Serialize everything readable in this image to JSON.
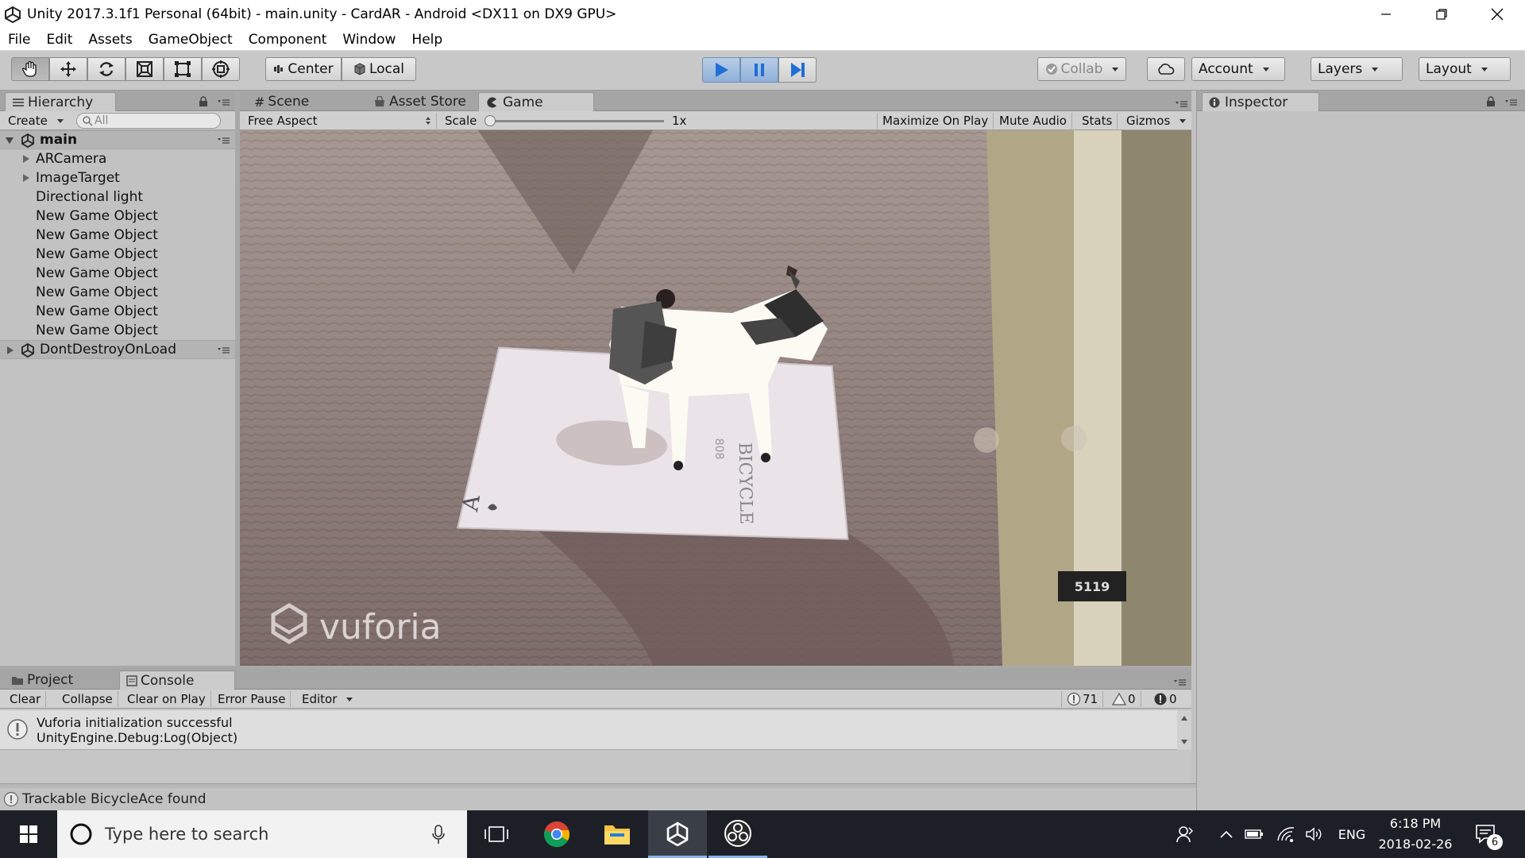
{
  "window": {
    "title": "Unity 2017.3.1f1 Personal (64bit) - main.unity - CardAR - Android <DX11 on DX9 GPU>"
  },
  "menu": [
    "File",
    "Edit",
    "Assets",
    "GameObject",
    "Component",
    "Window",
    "Help"
  ],
  "toolbar": {
    "pivot": "Center",
    "space": "Local",
    "collab": "Collab",
    "account": "Account",
    "layers": "Layers",
    "layout": "Layout"
  },
  "hierarchy": {
    "tab": "Hierarchy",
    "create": "Create",
    "search_placeholder": "All",
    "scene": "main",
    "items": [
      "ARCamera",
      "ImageTarget",
      "Directional light",
      "New Game Object",
      "New Game Object",
      "New Game Object",
      "New Game Object",
      "New Game Object",
      "New Game Object",
      "New Game Object"
    ],
    "dont_destroy": "DontDestroyOnLoad"
  },
  "center_tabs": {
    "scene": "Scene",
    "asset_store": "Asset Store",
    "game": "Game"
  },
  "game_bar": {
    "aspect": "Free Aspect",
    "scale_label": "Scale",
    "scale_value": "1x",
    "scale_fraction": 0,
    "maximize": "Maximize On Play",
    "mute": "Mute Audio",
    "stats": "Stats",
    "gizmos": "Gizmos"
  },
  "game_view": {
    "brand": "vuforia",
    "card_rank": "A",
    "card_brand": "BICYCLE",
    "card_number": "808",
    "door_sign": "5119"
  },
  "bottom_tabs": {
    "project": "Project",
    "console": "Console"
  },
  "console_bar": {
    "clear": "Clear",
    "collapse": "Collapse",
    "clear_on_play": "Clear on Play",
    "error_pause": "Error Pause",
    "editor": "Editor",
    "info_count": "71",
    "warn_count": "0",
    "error_count": "0"
  },
  "console_entry": {
    "line1": "Vuforia initialization successful",
    "line2": "UnityEngine.Debug:Log(Object)"
  },
  "status": "Trackable BicycleAce found",
  "inspector": {
    "tab": "Inspector"
  },
  "taskbar": {
    "search_placeholder": "Type here to search",
    "lang": "ENG",
    "time": "6:18 PM",
    "date": "2018-02-26",
    "notification_count": "6"
  }
}
